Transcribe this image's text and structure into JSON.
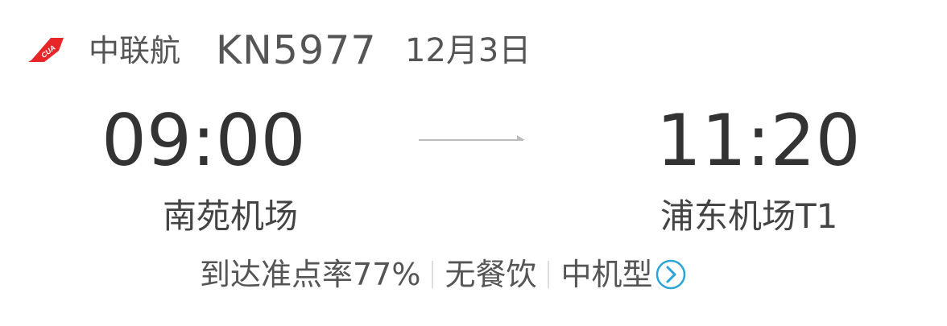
{
  "header": {
    "airline_name": "中联航",
    "flight_number": "KN5977",
    "date": "12月3日",
    "logo_icon": "cua-tail-logo",
    "logo_text": "CUA",
    "brand_color": "#e8262a"
  },
  "departure": {
    "time": "09:00",
    "airport": "南苑机场"
  },
  "arrival": {
    "time": "11:20",
    "airport": "浦东机场T1"
  },
  "info": {
    "on_time_rate": "到达准点率77%",
    "meal": "无餐饮",
    "aircraft_size": "中机型",
    "detail_icon": "chevron-right-circle-icon",
    "accent_color": "#2aa4d8"
  }
}
